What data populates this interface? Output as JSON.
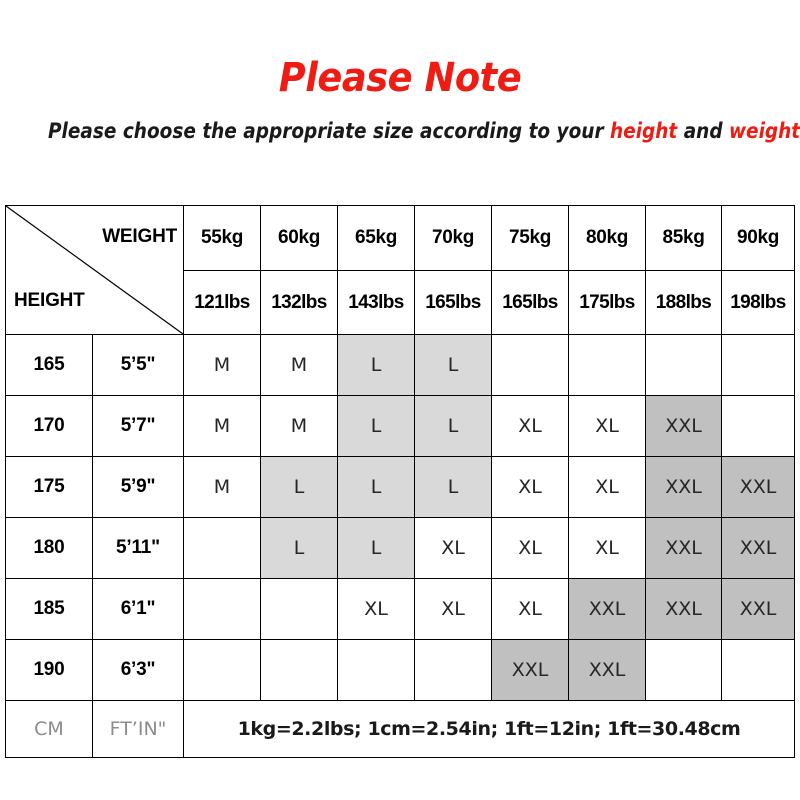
{
  "heading": {
    "title": "Please Note",
    "subtitle_pre": "Please choose the appropriate size according to your ",
    "subtitle_hl1": "height",
    "subtitle_mid": " and ",
    "subtitle_hl2": "weight"
  },
  "colors": {
    "title_red": "#ee1c13",
    "shade_light": "#d9d9d9",
    "shade_dark": "#c0c0c0",
    "text_dark": "#262626",
    "footer_label_gray": "#8c8c8c"
  },
  "table": {
    "corner": {
      "weight_label": "WEIGHT",
      "height_label": "HEIGHT"
    },
    "weight_kg": [
      "55kg",
      "60kg",
      "65kg",
      "70kg",
      "75kg",
      "80kg",
      "85kg",
      "90kg"
    ],
    "weight_lbs": [
      "121lbs",
      "132lbs",
      "143lbs",
      "165lbs",
      "165lbs",
      "175lbs",
      "188lbs",
      "198lbs"
    ],
    "rows": [
      {
        "height_cm": "165",
        "height_ft": "5’5\"",
        "cells": [
          {
            "size": "M",
            "shade": "none"
          },
          {
            "size": "M",
            "shade": "none"
          },
          {
            "size": "L",
            "shade": "light"
          },
          {
            "size": "L",
            "shade": "light"
          },
          {
            "size": "",
            "shade": "none"
          },
          {
            "size": "",
            "shade": "none"
          },
          {
            "size": "",
            "shade": "none"
          },
          {
            "size": "",
            "shade": "none"
          }
        ]
      },
      {
        "height_cm": "170",
        "height_ft": "5’7\"",
        "cells": [
          {
            "size": "M",
            "shade": "none"
          },
          {
            "size": "M",
            "shade": "none"
          },
          {
            "size": "L",
            "shade": "light"
          },
          {
            "size": "L",
            "shade": "light"
          },
          {
            "size": "XL",
            "shade": "none"
          },
          {
            "size": "XL",
            "shade": "none"
          },
          {
            "size": "XXL",
            "shade": "dark"
          },
          {
            "size": "",
            "shade": "none"
          }
        ]
      },
      {
        "height_cm": "175",
        "height_ft": "5’9\"",
        "cells": [
          {
            "size": "M",
            "shade": "none"
          },
          {
            "size": "L",
            "shade": "light"
          },
          {
            "size": "L",
            "shade": "light"
          },
          {
            "size": "L",
            "shade": "light"
          },
          {
            "size": "XL",
            "shade": "none"
          },
          {
            "size": "XL",
            "shade": "none"
          },
          {
            "size": "XXL",
            "shade": "dark"
          },
          {
            "size": "XXL",
            "shade": "dark"
          }
        ]
      },
      {
        "height_cm": "180",
        "height_ft": "5’11\"",
        "cells": [
          {
            "size": "",
            "shade": "none"
          },
          {
            "size": "L",
            "shade": "light"
          },
          {
            "size": "L",
            "shade": "light"
          },
          {
            "size": "XL",
            "shade": "none"
          },
          {
            "size": "XL",
            "shade": "none"
          },
          {
            "size": "XL",
            "shade": "none"
          },
          {
            "size": "XXL",
            "shade": "dark"
          },
          {
            "size": "XXL",
            "shade": "dark"
          }
        ]
      },
      {
        "height_cm": "185",
        "height_ft": "6’1\"",
        "cells": [
          {
            "size": "",
            "shade": "none"
          },
          {
            "size": "",
            "shade": "none"
          },
          {
            "size": "XL",
            "shade": "none"
          },
          {
            "size": "XL",
            "shade": "none"
          },
          {
            "size": "XL",
            "shade": "none"
          },
          {
            "size": "XXL",
            "shade": "dark"
          },
          {
            "size": "XXL",
            "shade": "dark"
          },
          {
            "size": "XXL",
            "shade": "dark"
          }
        ]
      },
      {
        "height_cm": "190",
        "height_ft": "6’3\"",
        "cells": [
          {
            "size": "",
            "shade": "none"
          },
          {
            "size": "",
            "shade": "none"
          },
          {
            "size": "",
            "shade": "none"
          },
          {
            "size": "",
            "shade": "none"
          },
          {
            "size": "XXL",
            "shade": "dark"
          },
          {
            "size": "XXL",
            "shade": "dark"
          },
          {
            "size": "",
            "shade": "none"
          },
          {
            "size": "",
            "shade": "none"
          }
        ]
      }
    ],
    "footer": {
      "cm_label": "CM",
      "ftin_label": "FT’IN\"",
      "conversion": "1kg=2.2lbs; 1cm=2.54in; 1ft=12in; 1ft=30.48cm"
    }
  }
}
